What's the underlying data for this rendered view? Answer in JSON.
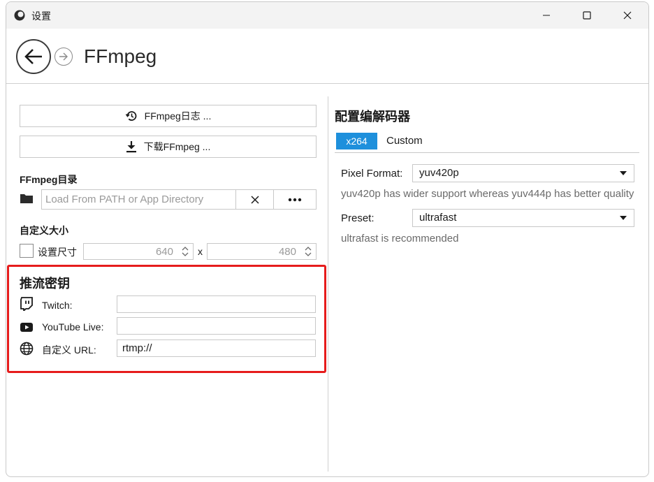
{
  "window": {
    "title": "设置"
  },
  "header": {
    "title": "FFmpeg"
  },
  "left": {
    "log_button": "FFmpeg日志 ...",
    "download_button": "下载FFmpeg ...",
    "dir_label": "FFmpeg目录",
    "dir_placeholder": "Load From PATH or App Directory",
    "custom_size_label": "自定义大小",
    "set_size_label": "设置尺寸",
    "width_value": "640",
    "x_sep": "x",
    "height_value": "480"
  },
  "stream": {
    "title": "推流密钥",
    "twitch_label": "Twitch:",
    "twitch_value": "",
    "youtube_label": "YouTube Live:",
    "youtube_value": "",
    "custom_label": "自定义 URL:",
    "custom_value": "rtmp://"
  },
  "codec": {
    "title": "配置编解码器",
    "tabs": [
      {
        "label": "x264",
        "active": true
      },
      {
        "label": "Custom",
        "active": false
      }
    ],
    "pixel_format_label": "Pixel Format:",
    "pixel_format_value": "yuv420p",
    "pixel_format_hint": "yuv420p has wider support whereas yuv444p has better quality",
    "preset_label": "Preset:",
    "preset_value": "ultrafast",
    "preset_hint": "ultrafast is recommended"
  },
  "colors": {
    "accent": "#1e90dc",
    "highlight": "#e61c1c"
  }
}
